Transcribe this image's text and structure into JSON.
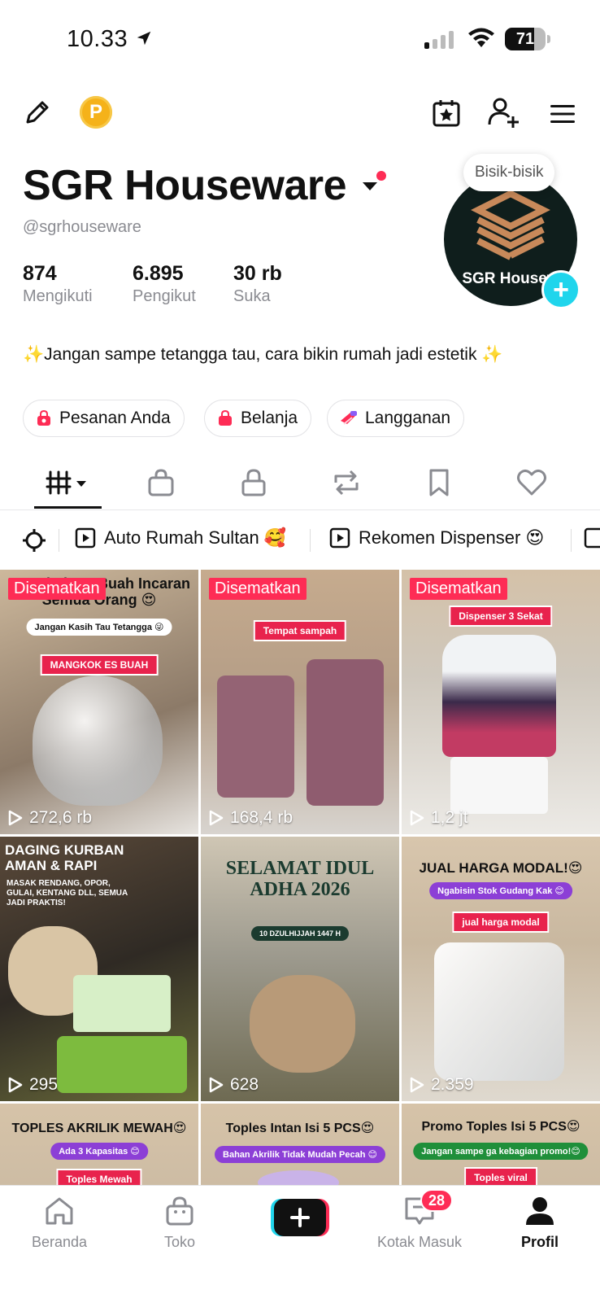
{
  "status_bar": {
    "time": "10.33",
    "battery_percent": "71",
    "battery_level": 0.71
  },
  "header_icons": {
    "edit": "pencil-icon",
    "points": "P",
    "calendar": "calendar-star-icon",
    "add_friend": "add-user-icon",
    "menu": "hamburger-menu-icon"
  },
  "profile": {
    "display_name": "SGR Houseware",
    "handle": "@sgrhouseware",
    "bubble_text": "Bisik-bisik",
    "avatar_text": "SGR Housew",
    "stats": [
      {
        "value": "874",
        "label": "Mengikuti"
      },
      {
        "value": "6.895",
        "label": "Pengikut"
      },
      {
        "value": "30 rb",
        "label": "Suka"
      }
    ],
    "bio": "✨Jangan sampe tetangga tau, cara bikin rumah jadi estetik ✨"
  },
  "pills": [
    {
      "label": "Pesanan Anda",
      "icon": "shopping-bag-icon"
    },
    {
      "label": "Belanja",
      "icon": "shopping-bag-icon"
    },
    {
      "label": "Langganan",
      "icon": "subscription-icon"
    }
  ],
  "tabs": [
    "videos-grid",
    "shop",
    "private",
    "reposts",
    "favorites",
    "liked"
  ],
  "playlists": [
    {
      "label": "Auto Rumah Sultan 🥰"
    },
    {
      "label": "Rekomen Dispenser 😍"
    }
  ],
  "videos": [
    {
      "pinned": "Disematkan",
      "views": "272,6 rb",
      "heading": "Mangkok Es Buah Incaran Semua Orang 😍",
      "sub": "Jangan Kasih Tau Tetangga 😜",
      "tag": "MANGKOK ES BUAH"
    },
    {
      "pinned": "Disematkan",
      "views": "168,4 rb",
      "heading": "",
      "sub": "",
      "tag": "Tempat sampah"
    },
    {
      "pinned": "Disematkan",
      "views": "1,2 jt",
      "heading": "",
      "sub": "",
      "tag": "Dispenser 3 Sekat"
    },
    {
      "pinned": "",
      "views": "295",
      "heading": "DAGING KURBAN AMAN & RAPI",
      "sub": "MASAK RENDANG, OPOR, GULAI, KENTANG DLL, SEMUA JADI PRAKTIS!",
      "tag": ""
    },
    {
      "pinned": "",
      "views": "628",
      "heading": "SELAMAT IDUL ADHA 2026",
      "sub": "10 DZULHIJJAH 1447 H",
      "tag": ""
    },
    {
      "pinned": "",
      "views": "2.359",
      "heading": "JUAL HARGA MODAL!😍",
      "sub": "Ngabisin Stok Gudang Kak 😊",
      "tag": "jual harga modal"
    },
    {
      "pinned": "",
      "views": "",
      "heading": "TOPLES AKRILIK MEWAH😍",
      "sub": "Ada 3 Kapasitas 😊",
      "tag": "Toples Mewah"
    },
    {
      "pinned": "",
      "views": "",
      "heading": "Toples Intan Isi 5 PCS😍",
      "sub": "Bahan Akrilik Tidak Mudah Pecah 😊",
      "tag": ""
    },
    {
      "pinned": "",
      "views": "",
      "heading": "Promo Toples Isi 5 PCS😍",
      "sub": "Jangan sampe ga kebagian promo!😊",
      "tag": "Toples viral"
    }
  ],
  "bottom_nav": {
    "home": "Beranda",
    "shop": "Toko",
    "inbox": "Kotak Masuk",
    "inbox_badge": "28",
    "profile": "Profil"
  },
  "colors": {
    "accent_red": "#fe2c55",
    "accent_cyan": "#20d5ec",
    "muted_text": "#8a8b91",
    "coin": "#f5b21a"
  }
}
